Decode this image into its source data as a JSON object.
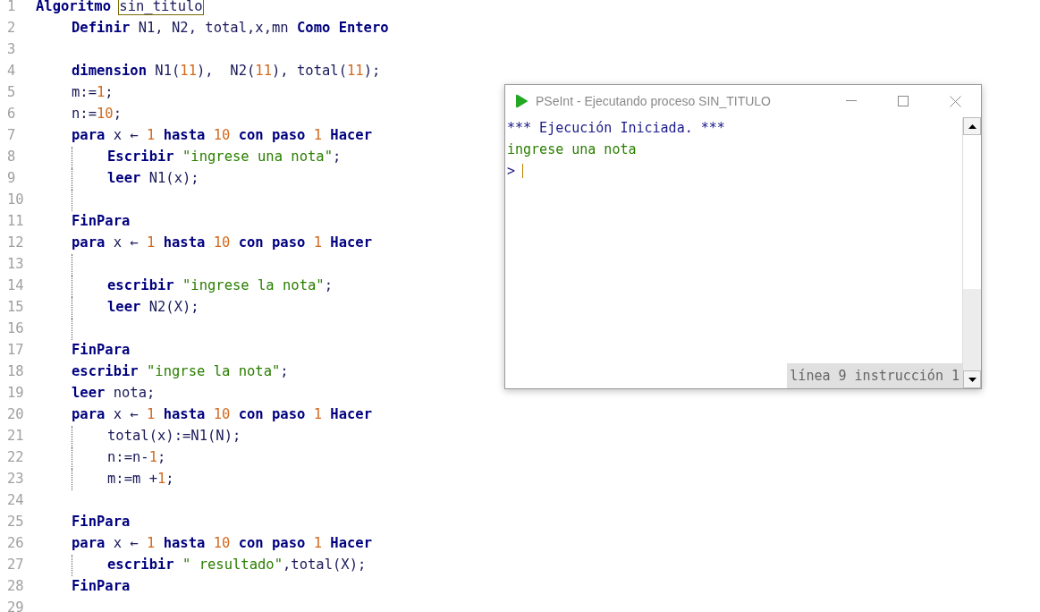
{
  "editor": {
    "lines": [
      {
        "number": "1",
        "tokens": [
          {
            "text": "Algoritmo ",
            "kind": "keyword"
          },
          {
            "text": "sin_titulo",
            "kind": "highlight"
          }
        ],
        "children": [
          {
            "number": "2",
            "tokens": [
              {
                "text": "Definir ",
                "kind": "keyword"
              },
              {
                "text": "N1, N2, total,x,mn ",
                "kind": "plain"
              },
              {
                "text": "Como Entero",
                "kind": "keyword"
              }
            ]
          },
          {
            "number": "3"
          },
          {
            "number": "4",
            "tokens": [
              {
                "text": "dimension ",
                "kind": "keyword"
              },
              {
                "text": "N1(",
                "kind": "plain"
              },
              {
                "text": "11",
                "kind": "number"
              },
              {
                "text": "),  N2(",
                "kind": "plain"
              },
              {
                "text": "11",
                "kind": "number"
              },
              {
                "text": "), total(",
                "kind": "plain"
              },
              {
                "text": "11",
                "kind": "number"
              },
              {
                "text": ");",
                "kind": "plain"
              }
            ]
          },
          {
            "number": "5",
            "tokens": [
              {
                "text": "m:=",
                "kind": "plain"
              },
              {
                "text": "1",
                "kind": "number"
              },
              {
                "text": ";",
                "kind": "plain"
              }
            ]
          },
          {
            "number": "6",
            "tokens": [
              {
                "text": "n:=",
                "kind": "plain"
              },
              {
                "text": "10",
                "kind": "number"
              },
              {
                "text": ";",
                "kind": "plain"
              }
            ]
          },
          {
            "number": "7",
            "tokens": [
              {
                "text": "para ",
                "kind": "keyword"
              },
              {
                "text": "x ← ",
                "kind": "plain"
              },
              {
                "text": "1",
                "kind": "number"
              },
              {
                "text": " hasta ",
                "kind": "keyword"
              },
              {
                "text": "10",
                "kind": "number"
              },
              {
                "text": " con paso ",
                "kind": "keyword"
              },
              {
                "text": "1",
                "kind": "number"
              },
              {
                "text": " Hacer",
                "kind": "keyword"
              }
            ],
            "children": [
              {
                "number": "8",
                "tokens": [
                  {
                    "text": "Escribir ",
                    "kind": "keyword"
                  },
                  {
                    "text": "\"ingrese una nota\"",
                    "kind": "string"
                  },
                  {
                    "text": ";",
                    "kind": "plain"
                  }
                ]
              },
              {
                "number": "9",
                "tokens": [
                  {
                    "text": "leer ",
                    "kind": "keyword"
                  },
                  {
                    "text": "N1(x);",
                    "kind": "plain"
                  }
                ]
              },
              {
                "number": "10"
              }
            ]
          },
          {
            "number": "11",
            "tokens": [
              {
                "text": "FinPara",
                "kind": "keyword"
              }
            ]
          },
          {
            "number": "12",
            "tokens": [
              {
                "text": "para ",
                "kind": "keyword"
              },
              {
                "text": "x ← ",
                "kind": "plain"
              },
              {
                "text": "1",
                "kind": "number"
              },
              {
                "text": " hasta ",
                "kind": "keyword"
              },
              {
                "text": "10",
                "kind": "number"
              },
              {
                "text": " con paso ",
                "kind": "keyword"
              },
              {
                "text": "1",
                "kind": "number"
              },
              {
                "text": " Hacer",
                "kind": "keyword"
              }
            ],
            "children": [
              {
                "number": "13"
              },
              {
                "number": "14",
                "tokens": [
                  {
                    "text": "escribir ",
                    "kind": "keyword"
                  },
                  {
                    "text": "\"ingrese la nota\"",
                    "kind": "string"
                  },
                  {
                    "text": ";",
                    "kind": "plain"
                  }
                ]
              },
              {
                "number": "15",
                "tokens": [
                  {
                    "text": "leer ",
                    "kind": "keyword"
                  },
                  {
                    "text": "N2(X);",
                    "kind": "plain"
                  }
                ]
              },
              {
                "number": "16"
              }
            ]
          },
          {
            "number": "17",
            "tokens": [
              {
                "text": "FinPara",
                "kind": "keyword"
              }
            ]
          },
          {
            "number": "18",
            "tokens": [
              {
                "text": "escribir ",
                "kind": "keyword"
              },
              {
                "text": "\"ingrse la nota\"",
                "kind": "string"
              },
              {
                "text": ";",
                "kind": "plain"
              }
            ]
          },
          {
            "number": "19",
            "tokens": [
              {
                "text": "leer ",
                "kind": "keyword"
              },
              {
                "text": "nota;",
                "kind": "plain"
              }
            ]
          },
          {
            "number": "20",
            "tokens": [
              {
                "text": "para ",
                "kind": "keyword"
              },
              {
                "text": "x ← ",
                "kind": "plain"
              },
              {
                "text": "1",
                "kind": "number"
              },
              {
                "text": " hasta ",
                "kind": "keyword"
              },
              {
                "text": "10",
                "kind": "number"
              },
              {
                "text": " con paso ",
                "kind": "keyword"
              },
              {
                "text": "1",
                "kind": "number"
              },
              {
                "text": " Hacer",
                "kind": "keyword"
              }
            ],
            "children": [
              {
                "number": "21",
                "tokens": [
                  {
                    "text": "total(x):=N1(N);",
                    "kind": "plain"
                  }
                ]
              },
              {
                "number": "22",
                "tokens": [
                  {
                    "text": "n:=n-",
                    "kind": "plain"
                  },
                  {
                    "text": "1",
                    "kind": "number"
                  },
                  {
                    "text": ";",
                    "kind": "plain"
                  }
                ]
              },
              {
                "number": "23",
                "tokens": [
                  {
                    "text": "m:=m +",
                    "kind": "plain"
                  },
                  {
                    "text": "1",
                    "kind": "number"
                  },
                  {
                    "text": ";",
                    "kind": "plain"
                  }
                ]
              }
            ]
          },
          {
            "number": "24"
          },
          {
            "number": "25",
            "tokens": [
              {
                "text": "FinPara",
                "kind": "keyword"
              }
            ]
          },
          {
            "number": "26",
            "tokens": [
              {
                "text": "para ",
                "kind": "keyword"
              },
              {
                "text": "x ← ",
                "kind": "plain"
              },
              {
                "text": "1",
                "kind": "number"
              },
              {
                "text": " hasta ",
                "kind": "keyword"
              },
              {
                "text": "10",
                "kind": "number"
              },
              {
                "text": " con paso ",
                "kind": "keyword"
              },
              {
                "text": "1",
                "kind": "number"
              },
              {
                "text": " Hacer",
                "kind": "keyword"
              }
            ],
            "children": [
              {
                "number": "27",
                "tokens": [
                  {
                    "text": "escribir ",
                    "kind": "keyword"
                  },
                  {
                    "text": "\" resultado\"",
                    "kind": "string"
                  },
                  {
                    "text": ",total(X);",
                    "kind": "plain"
                  }
                ]
              }
            ]
          },
          {
            "number": "28",
            "tokens": [
              {
                "text": "FinPara",
                "kind": "keyword"
              }
            ]
          }
        ]
      },
      {
        "number": "29"
      }
    ]
  },
  "run_window": {
    "title": "PSeInt - Ejecutando proceso SIN_TITULO",
    "output": [
      {
        "text": "*** Ejecución Iniciada. ***",
        "kind": "info"
      },
      {
        "text": "ingrese una nota",
        "kind": "output"
      },
      {
        "text": ">",
        "kind": "prompt"
      }
    ],
    "status": "línea 9 instrucción 1"
  }
}
